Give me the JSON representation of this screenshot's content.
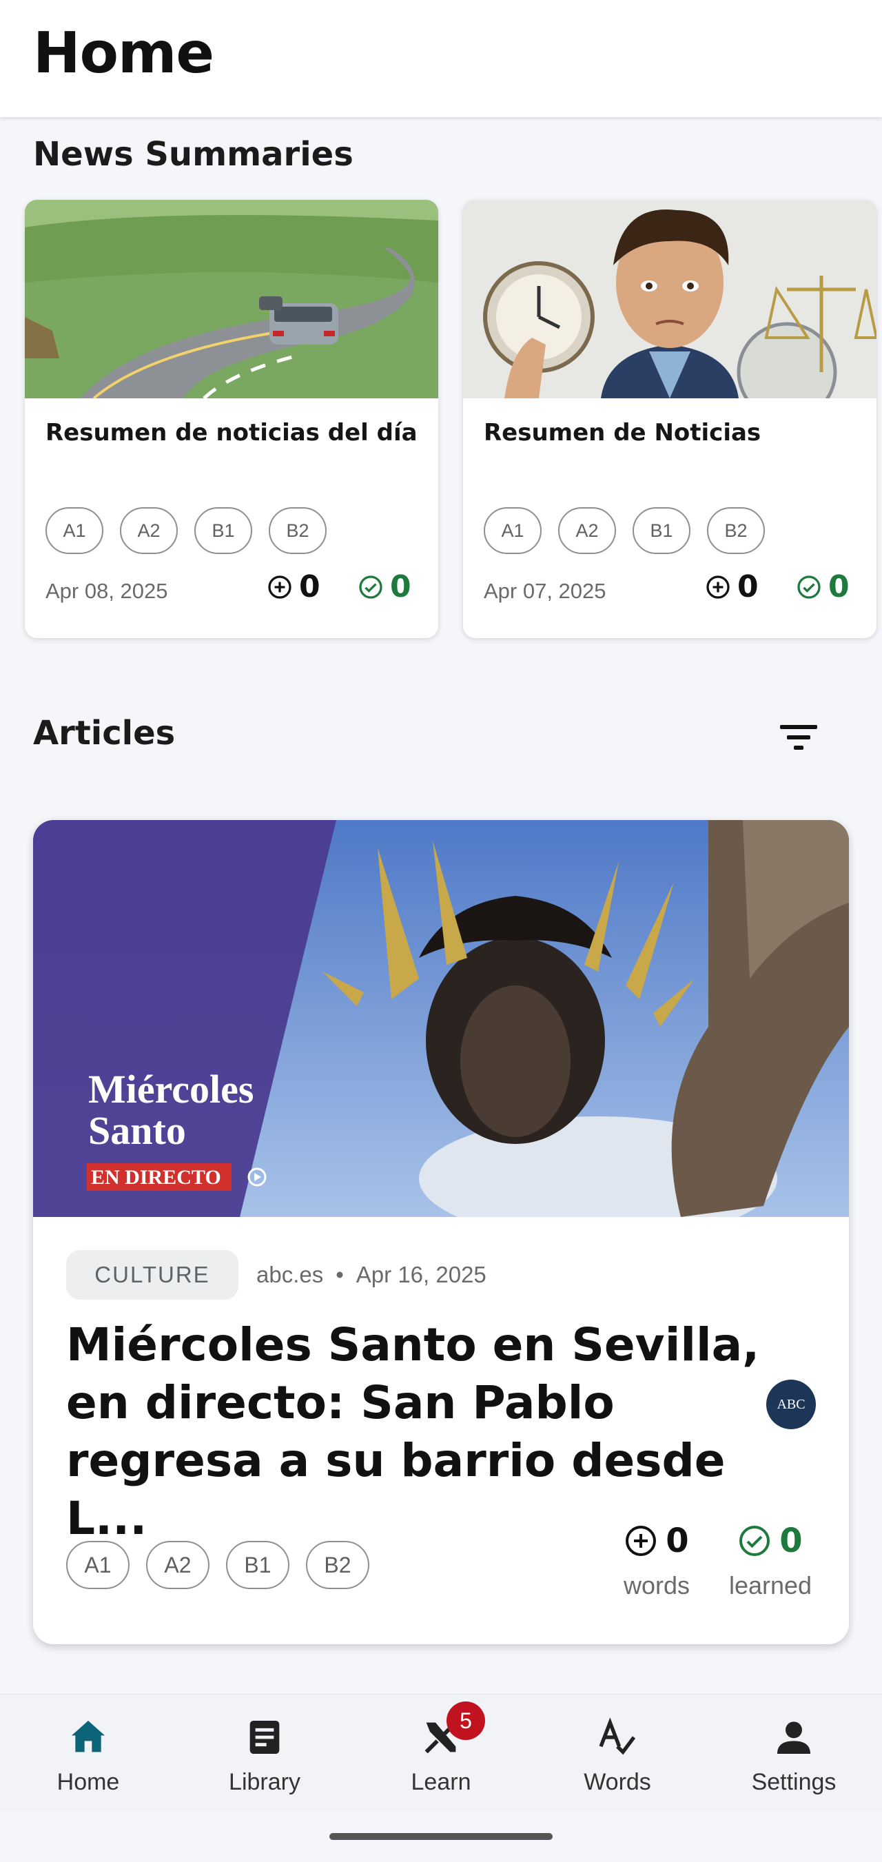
{
  "header": {
    "title": "Home"
  },
  "news": {
    "section_title": "News Summaries",
    "cards": [
      {
        "title": "Resumen de noticias del día",
        "levels": [
          "A1",
          "A2",
          "B1",
          "B2"
        ],
        "date": "Apr 08, 2025",
        "words": "0",
        "learned": "0"
      },
      {
        "title": "Resumen de Noticias",
        "levels": [
          "A1",
          "A2",
          "B1",
          "B2"
        ],
        "date": "Apr 07, 2025",
        "words": "0",
        "learned": "0"
      }
    ]
  },
  "articles": {
    "section_title": "Articles",
    "items": [
      {
        "image_text": {
          "line1": "Miércoles",
          "line2": "Santo",
          "tag": "EN DIRECTO"
        },
        "category": "CULTURE",
        "source": "abc.es",
        "separator": "•",
        "date": "Apr 16, 2025",
        "title_lines": [
          "Miércoles Santo en Sevilla,",
          "en directo: San Pablo",
          "regresa a su barrio desde L..."
        ],
        "source_logo": "ABC",
        "levels": [
          "A1",
          "A2",
          "B1",
          "B2"
        ],
        "words": "0",
        "words_label": "words",
        "learned": "0",
        "learned_label": "learned"
      }
    ]
  },
  "nav": {
    "items": [
      {
        "label": "Home",
        "icon": "home-icon",
        "active": true
      },
      {
        "label": "Library",
        "icon": "library-icon"
      },
      {
        "label": "Learn",
        "icon": "learn-icon",
        "badge": "5"
      },
      {
        "label": "Words",
        "icon": "words-icon"
      },
      {
        "label": "Settings",
        "icon": "person-icon"
      }
    ]
  },
  "colors": {
    "accent": "#0b6477",
    "learned": "#1e7a3c",
    "badge": "#c1121f"
  }
}
